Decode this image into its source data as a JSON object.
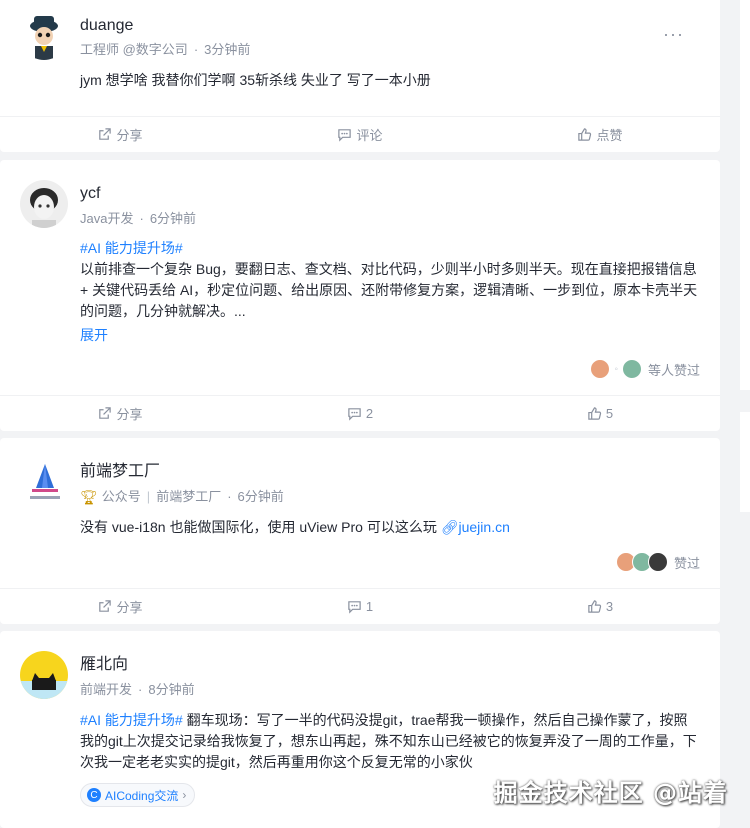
{
  "posts": [
    {
      "author": "duange",
      "meta_title": "工程师 @数字公司",
      "time": "3分钟前",
      "more": "···",
      "content": "jym 想学啥 我替你们学啊 35斩杀线 失业了 写了一本小册",
      "actions": {
        "share": "分享",
        "comment": "评论",
        "like": "点赞"
      }
    },
    {
      "author": "ycf",
      "meta_title": "Java开发",
      "time": "6分钟前",
      "topic": "#AI 能力提升场#",
      "content": "以前排查一个复杂 Bug，要翻日志、查文档、对比代码，少则半小时多则半天。现在直接把报错信息 + 关键代码丢给 AI，秒定位问题、给出原因、还附带修复方案，逻辑清晰、一步到位，原本卡壳半天的问题，几分钟就解决。...",
      "expand": "展开",
      "likers_text": "等人赞过",
      "actions": {
        "share": "分享",
        "comment": "2",
        "like": "5"
      }
    },
    {
      "author": "前端梦工厂",
      "badge": "公众号",
      "meta_title": "前端梦工厂",
      "time": "6分钟前",
      "content": "没有 vue-i18n 也能做国际化，使用 uView Pro 可以这么玩 ",
      "link": "juejin.cn",
      "likers_text": "赞过",
      "actions": {
        "share": "分享",
        "comment": "1",
        "like": "3"
      }
    },
    {
      "author": "雁北向",
      "meta_title": "前端开发",
      "time": "8分钟前",
      "topic": "#AI 能力提升场#",
      "content": " 翻车现场：写了一半的代码没提git，trae帮我一顿操作，然后自己操作蒙了，按照我的git上次提交记录给我恢复了，想东山再起，殊不知东山已经被它的恢复弄没了一周的工作量，下次我一定老老实实的提git，然后再重用你这个反复无常的小家伙",
      "tag": "AICoding交流"
    }
  ],
  "watermark": "掘金技术社区 @站着",
  "colors": {
    "accent": "#1e80ff",
    "meta": "#8a919f",
    "background": "#f2f3f5"
  }
}
